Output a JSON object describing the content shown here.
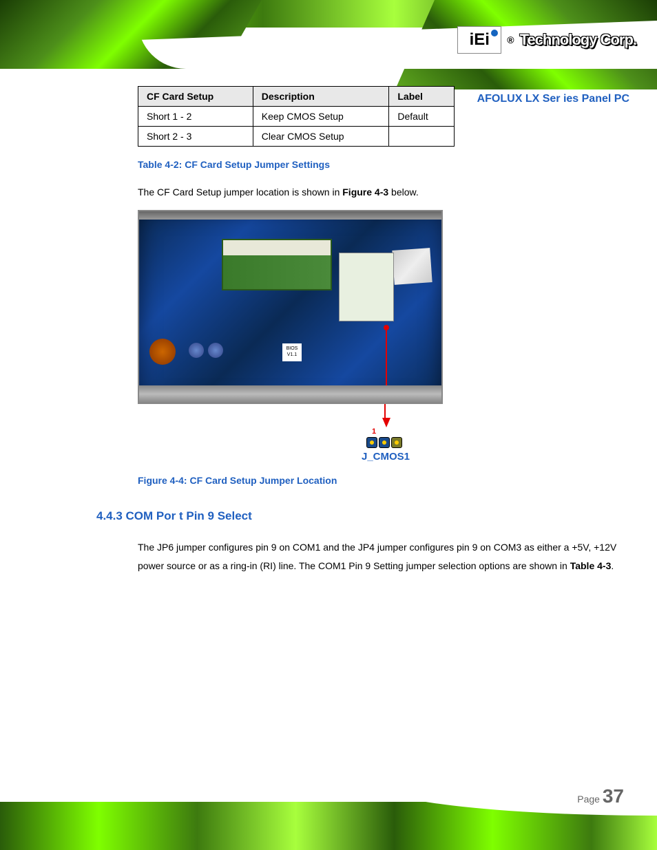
{
  "header": {
    "logo_text": "iEi",
    "reg_mark": "®",
    "brand": "Technology Corp."
  },
  "doc_title": "AFOLUX LX Ser ies Panel PC",
  "table": {
    "headers": [
      "CF Card Setup",
      "Description",
      "Label"
    ],
    "rows": [
      [
        "Short 1 - 2",
        "Keep CMOS Setup",
        "Default"
      ],
      [
        "Short 2 - 3",
        "Clear CMOS Setup",
        ""
      ]
    ]
  },
  "table_caption": "Table 4-2: CF Card Setup Jumper Settings",
  "location_text_pre": "The CF Card Setup jumper location is shown in ",
  "location_text_ref": "Figure 4-3",
  "location_text_post": " below.",
  "bios_label": "BIOS V1.1",
  "jumper": {
    "pin1_label": "1",
    "name": "J_CMOS1"
  },
  "figure_caption": "Figure 4-4: CF Card Setup Jumper Location",
  "section_heading": "4.4.3 COM Por t Pin 9 Select",
  "body_para": "The JP6 jumper configures pin 9 on COM1 and the JP4 jumper configures pin 9 on COM3 as either a +5V, +12V power source or as a ring-in (RI) line. The COM1 Pin 9 Setting jumper selection options are shown in ",
  "body_para_ref": "Table 4-3",
  "body_para_post": ".",
  "footer": {
    "page_label": "Page ",
    "page_num": "37"
  }
}
